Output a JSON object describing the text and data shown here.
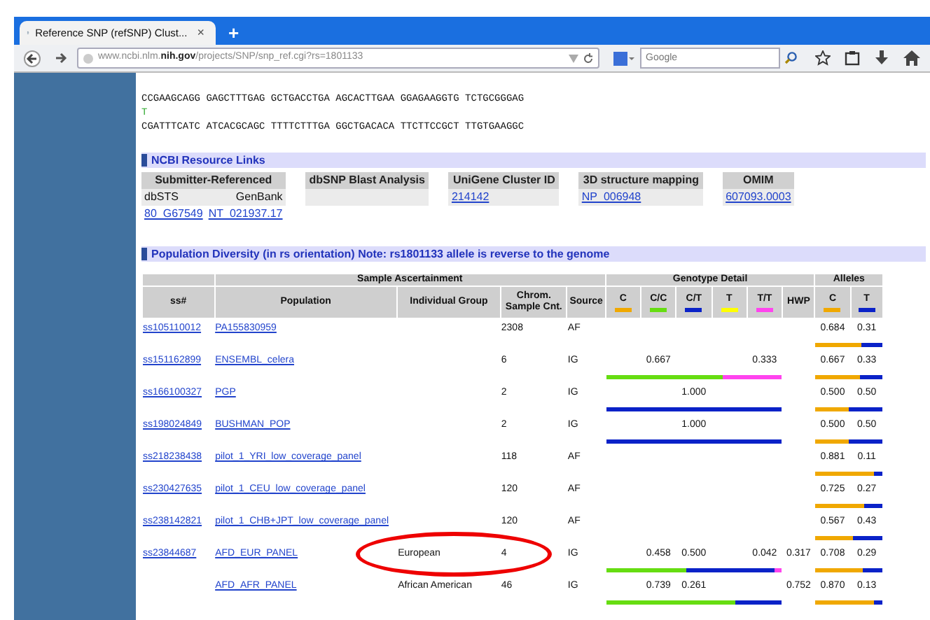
{
  "browser": {
    "tab_title": "Reference SNP (refSNP) Clust...",
    "tab_close": "×",
    "new_tab": "+",
    "url": "www.ncbi.nlm.**nih.gov**/projects/SNP/snp_ref.cgi?rs=1801133",
    "search": {
      "placeholder": "Google"
    }
  },
  "sequence_lines": [
    {
      "kind": "sequence",
      "text": "CCGAAGCAGG GAGCTTTGAG GCTGACCTGA AGCACTTGAA GGAGAAGGTG TCTGCGGGAG"
    },
    {
      "kind": "allele",
      "text": "T"
    },
    {
      "kind": "sequence",
      "text": "CGATTTCATC ATCACGCAGC TTTTCTTTGA GGCTGACACA TTCTTCCGCT TTGTGAAGGC"
    }
  ],
  "resource_links": {
    "title": "NCBI Resource Links",
    "columns": [
      {
        "label": "Submitter-Referenced",
        "lines": [
          [
            {
              "text": "dbSTS",
              "link": false
            },
            {
              "text": "GenBank",
              "link": false
            }
          ],
          [
            {
              "text": "80_G67549",
              "link": true
            },
            {
              "text": "NT_021937.17",
              "link": true
            }
          ]
        ]
      },
      {
        "label": "dbSNP Blast Analysis"
      },
      {
        "label": "UniGene Cluster ID",
        "lines": [
          [
            {
              "text": "214142",
              "link": true
            }
          ]
        ]
      },
      {
        "label": "3D structure mapping",
        "lines": [
          [
            {
              "text": "NP_006948",
              "link": true
            }
          ]
        ]
      },
      {
        "label": "OMIM",
        "lines": [
          [
            {
              "text": "607093.0003",
              "link": true
            }
          ]
        ]
      }
    ]
  },
  "population": {
    "title": "Population Diversity (in rs orientation) Note: rs1801133 allele is reverse to the genome",
    "groups": [
      {
        "columns": [
          {
            "label": "ss#"
          }
        ]
      },
      {
        "label": "Sample Ascertainment",
        "columns": [
          {
            "label": "Population"
          },
          {
            "label": "Individual Group"
          },
          {
            "label": "Chrom. Sample Cnt."
          },
          {
            "label": "Source"
          }
        ]
      },
      {
        "label": "Genotype Detail",
        "columns": [
          {
            "label": "C",
            "color": "#f0a800"
          },
          {
            "label": "C/C",
            "color": "#66dd11"
          },
          {
            "label": "C/T",
            "color": "#0a22c8"
          },
          {
            "label": "T",
            "color": "#ffff00"
          },
          {
            "label": "T/T",
            "color": "#ff44ee"
          },
          {
            "label": "HWP"
          }
        ]
      },
      {
        "label": "Alleles",
        "columns": [
          {
            "label": "C",
            "color": "#f0a800"
          },
          {
            "label": "T",
            "color": "#0a22c8"
          }
        ]
      }
    ],
    "rows": [
      {
        "ss": "ss105110012",
        "population": "PA155830959",
        "chrom": "2308",
        "source": "AF",
        "genotype": {},
        "alleles": {
          "c": "0.684",
          "t": "0.31"
        },
        "allele_bar": [
          {
            "color": "#f0a800",
            "level": 0.684
          },
          {
            "color": "#0a22c8",
            "level": 0.316
          }
        ]
      },
      {
        "ss": "ss151162899",
        "population": "ENSEMBL_celera",
        "chrom": "6",
        "source": "IG",
        "genotype": {
          "cc": "0.667",
          "tt": "0.333"
        },
        "alleles": {
          "c": "0.667",
          "t": "0.33"
        },
        "genotype_bar": [
          {
            "color": "#66dd11",
            "level": 0.667
          },
          {
            "color": "#ff44ee",
            "level": 0.333
          }
        ],
        "allele_bar": [
          {
            "color": "#f0a800",
            "level": 0.667
          },
          {
            "color": "#0a22c8",
            "level": 0.333
          }
        ]
      },
      {
        "ss": "ss166100327",
        "population": "PGP",
        "chrom": "2",
        "source": "IG",
        "genotype": {
          "ct": "1.000"
        },
        "alleles": {
          "c": "0.500",
          "t": "0.50"
        },
        "genotype_bar": [
          {
            "color": "#0a22c8",
            "level": 1
          }
        ],
        "allele_bar": [
          {
            "color": "#f0a800",
            "level": 0.5
          },
          {
            "color": "#0a22c8",
            "level": 0.5
          }
        ]
      },
      {
        "ss": "ss198024849",
        "population": "BUSHMAN_POP",
        "chrom": "2",
        "source": "IG",
        "genotype": {
          "ct": "1.000"
        },
        "alleles": {
          "c": "0.500",
          "t": "0.50"
        },
        "genotype_bar": [
          {
            "color": "#0a22c8",
            "level": 1
          }
        ],
        "allele_bar": [
          {
            "color": "#f0a800",
            "level": 0.5
          },
          {
            "color": "#0a22c8",
            "level": 0.5
          }
        ]
      },
      {
        "ss": "ss218238438",
        "population": "pilot_1_YRI_low_coverage_panel",
        "chrom": "118",
        "source": "AF",
        "genotype": {},
        "alleles": {
          "c": "0.881",
          "t": "0.11"
        },
        "allele_bar": [
          {
            "color": "#f0a800",
            "level": 0.881
          },
          {
            "color": "#0a22c8",
            "level": 0.119
          }
        ]
      },
      {
        "ss": "ss230427635",
        "population": "pilot_1_CEU_low_coverage_panel",
        "chrom": "120",
        "source": "AF",
        "genotype": {},
        "alleles": {
          "c": "0.725",
          "t": "0.27"
        },
        "allele_bar": [
          {
            "color": "#f0a800",
            "level": 0.725
          },
          {
            "color": "#0a22c8",
            "level": 0.275
          }
        ]
      },
      {
        "ss": "ss238142821",
        "population": "pilot_1_CHB+JPT_low_coverage_panel",
        "chrom": "120",
        "source": "AF",
        "genotype": {},
        "alleles": {
          "c": "0.567",
          "t": "0.43"
        },
        "allele_bar": [
          {
            "color": "#f0a800",
            "level": 0.567
          },
          {
            "color": "#0a22c8",
            "level": 0.433
          }
        ]
      },
      {
        "ss": "ss23844687",
        "population": "AFD_EUR_PANEL",
        "group": "European",
        "chrom": "4",
        "source": "IG",
        "genotype": {
          "cc": "0.458",
          "ct": "0.500",
          "tt": "0.042",
          "hwp": "0.317"
        },
        "alleles": {
          "c": "0.708",
          "t": "0.29"
        },
        "genotype_bar": [
          {
            "color": "#66dd11",
            "level": 0.458
          },
          {
            "color": "#0a22c8",
            "level": 0.5
          },
          {
            "color": "#ff44ee",
            "level": 0.042
          }
        ],
        "allele_bar": [
          {
            "color": "#f0a800",
            "level": 0.708
          },
          {
            "color": "#0a22c8",
            "level": 0.292
          }
        ],
        "circled": true
      },
      {
        "population": "AFD_AFR_PANEL",
        "group": "African American",
        "chrom": "46",
        "source": "IG",
        "genotype": {
          "cc": "0.739",
          "ct": "0.261",
          "hwp": "0.752"
        },
        "alleles": {
          "c": "0.870",
          "t": "0.13"
        },
        "genotype_bar": [
          {
            "color": "#66dd11",
            "level": 0.739
          },
          {
            "color": "#0a22c8",
            "level": 0.261
          }
        ],
        "allele_bar": [
          {
            "color": "#f0a800",
            "level": 0.87
          },
          {
            "color": "#0a22c8",
            "level": 0.13
          }
        ]
      }
    ]
  }
}
